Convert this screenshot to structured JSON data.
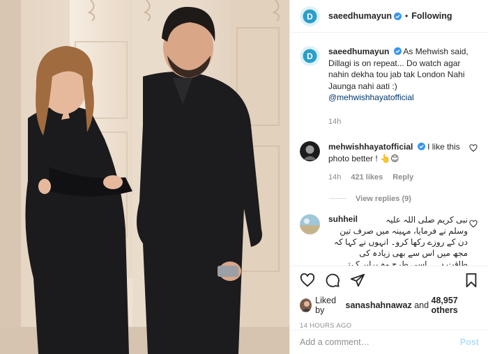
{
  "header": {
    "username": "saeedhumayun",
    "separator": "•",
    "follow_status": "Following"
  },
  "caption": {
    "username": "saeedhumayun",
    "text": "As Mehwish said, Dillagi is on repeat... Do watch agar nahin dekha tou jab tak London Nahi Jaunga nahi aati :)",
    "mention": "@mehwishhayatofficial",
    "time": "14h"
  },
  "comments": [
    {
      "username": "mehwishhayatofficial",
      "text": "I like this photo better ! 👆😊",
      "time": "14h",
      "likes": "421 likes",
      "reply_label": "Reply",
      "view_replies": "View replies (9)"
    },
    {
      "username": "suhheil",
      "text_lines": [
        "نبی کریم صلی اللہ علیہ",
        "وسلم نے فرمایا، مہینہ میں صرف تین",
        "دن کے روزے رکھا کرو۔ انہوں نے کہا کہ",
        "مجھ میں اس سے بھی زیادہ کی",
        "طاقت ہے۔ اسی طرح وہ برابر کہتے"
      ]
    }
  ],
  "likes": {
    "prefix": "Liked by",
    "user": "sanashahnawaz",
    "middle": "and",
    "others": "48,957 others"
  },
  "timestamp": "14 HOURS AGO",
  "add_comment": {
    "placeholder": "Add a comment…",
    "post_label": "Post"
  },
  "colors": {
    "verified": "#3897f0",
    "link": "#00376b",
    "muted": "#8e8e8e",
    "post_disabled": "#b2dffc"
  }
}
